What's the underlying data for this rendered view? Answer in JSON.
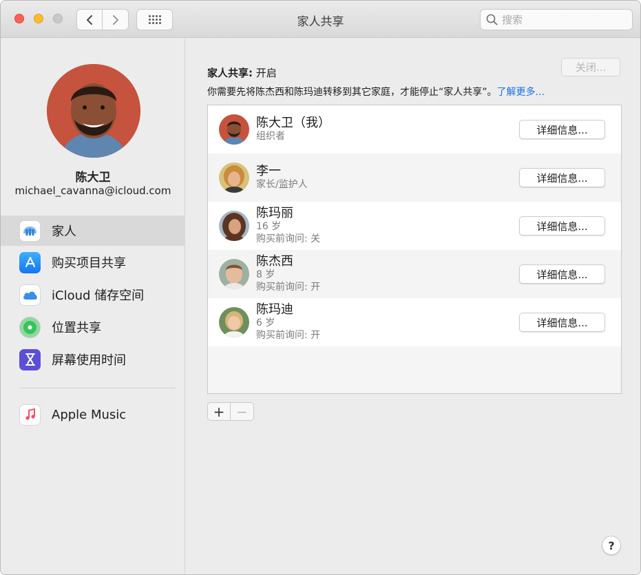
{
  "window": {
    "title": "家人共享"
  },
  "search": {
    "placeholder": "搜索",
    "icon": "search-icon"
  },
  "account": {
    "name": "陈大卫",
    "email": "michael_cavanna@icloud.com"
  },
  "sidebar": {
    "items": [
      {
        "label": "家人",
        "icon": "family-icon",
        "selected": true
      },
      {
        "label": "购买项目共享",
        "icon": "app-store-icon"
      },
      {
        "label": "iCloud 储存空间",
        "icon": "icloud-icon"
      },
      {
        "label": "位置共享",
        "icon": "find-my-icon"
      },
      {
        "label": "屏幕使用时间",
        "icon": "screen-time-icon"
      }
    ],
    "extra_items": [
      {
        "label": "Apple Music",
        "icon": "music-icon"
      }
    ]
  },
  "main": {
    "status_label": "家人共享:",
    "status_value": "开启",
    "close_label": "关闭...",
    "notice_text": "你需要先将陈杰西和陈玛迪转移到其它家庭，才能停止“家人共享”。",
    "learn_more": "了解更多...",
    "detail_label": "详细信息...",
    "members": [
      {
        "name": "陈大卫（我）",
        "role": "组织者",
        "purchase": ""
      },
      {
        "name": "李一",
        "role": "家长/监护人",
        "purchase": ""
      },
      {
        "name": "陈玛丽",
        "role": "16 岁",
        "purchase": "购买前询问: 关"
      },
      {
        "name": "陈杰西",
        "role": "8 岁",
        "purchase": "购买前询问: 开"
      },
      {
        "name": "陈玛迪",
        "role": "6 岁",
        "purchase": "购买前询问: 开"
      }
    ],
    "add_symbol": "+",
    "remove_symbol": "−",
    "help_symbol": "?"
  }
}
